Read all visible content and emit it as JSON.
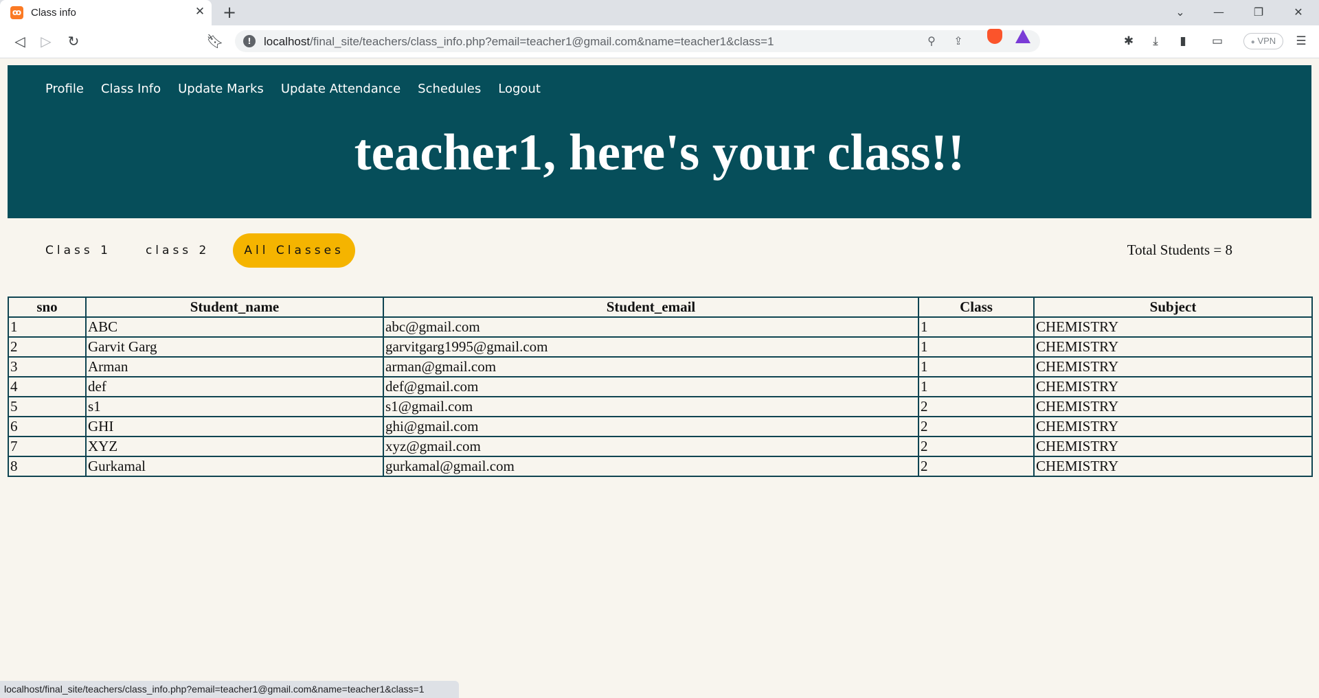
{
  "browser": {
    "tab_title": "Class info",
    "tab_favicon": "xampp-icon",
    "new_tab_symbol": "+",
    "url_host": "localhost",
    "url_path": "/final_site/teachers/class_info.php?email=teacher1@gmail.com&name=teacher1&class=1",
    "vpn_label": "VPN",
    "status_url": "localhost/final_site/teachers/class_info.php?email=teacher1@gmail.com&name=teacher1&class=1"
  },
  "nav": {
    "links": [
      "Profile",
      "Class Info",
      "Update Marks",
      "Update Attendance",
      "Schedules",
      "Logout"
    ]
  },
  "hero": {
    "title": "teacher1, here's your class!!"
  },
  "filters": {
    "buttons": [
      "Class 1",
      "class 2",
      "All Classes"
    ],
    "active": "All Classes",
    "total_label": "Total Students = 8"
  },
  "table": {
    "headers": [
      "sno",
      "Student_name",
      "Student_email",
      "Class",
      "Subject"
    ],
    "rows": [
      [
        "1",
        "ABC",
        "abc@gmail.com",
        "1",
        "CHEMISTRY"
      ],
      [
        "2",
        "Garvit Garg",
        "garvitgarg1995@gmail.com",
        "1",
        "CHEMISTRY"
      ],
      [
        "3",
        "Arman",
        "arman@gmail.com",
        "1",
        "CHEMISTRY"
      ],
      [
        "4",
        "def",
        "def@gmail.com",
        "1",
        "CHEMISTRY"
      ],
      [
        "5",
        "s1",
        "s1@gmail.com",
        "2",
        "CHEMISTRY"
      ],
      [
        "6",
        "GHI",
        "ghi@gmail.com",
        "2",
        "CHEMISTRY"
      ],
      [
        "7",
        "XYZ",
        "xyz@gmail.com",
        "2",
        "CHEMISTRY"
      ],
      [
        "8",
        "Gurkamal",
        "gurkamal@gmail.com",
        "2",
        "CHEMISTRY"
      ]
    ]
  },
  "colors": {
    "header_bg": "#064e5a",
    "page_bg": "#f8f5ee",
    "active_filter": "#f5b400",
    "table_border": "#0f4451"
  }
}
